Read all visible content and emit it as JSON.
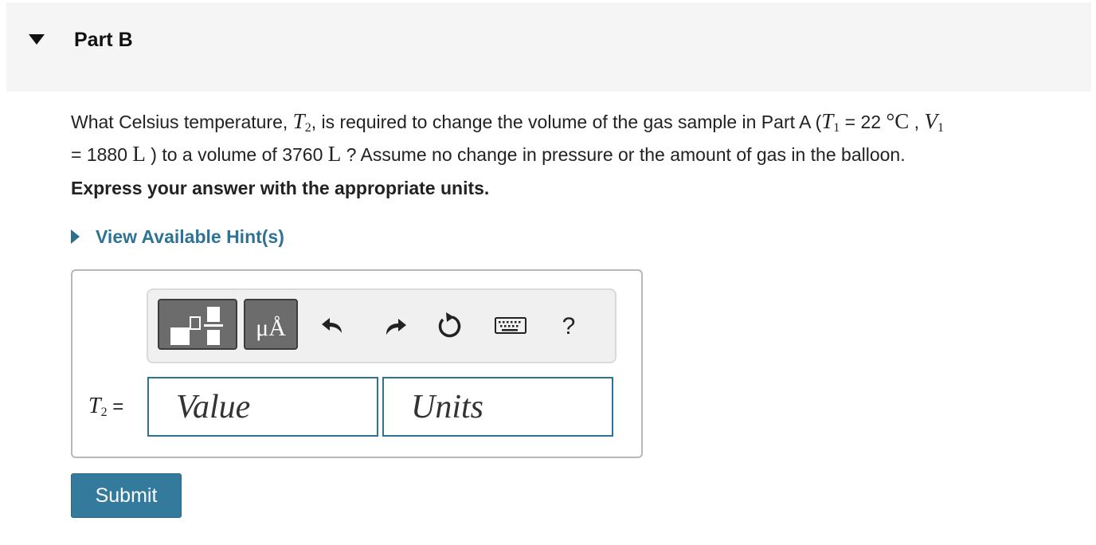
{
  "part": {
    "title": "Part B"
  },
  "question": {
    "text_1": "What Celsius temperature, ",
    "t2_var": "T",
    "t2_sub": "2",
    "text_2": ", is required to change the volume of the gas sample in Part A (",
    "t1_var": "T",
    "t1_sub": "1",
    "t1_eq": " = 22 ",
    "t1_unit": "°C",
    "comma": " , ",
    "v1_var": "V",
    "v1_sub": "1",
    "v1_eq": " = 1880 ",
    "v1_unit": "L",
    "text_3": " ) to a volume of 3760 ",
    "v2_unit": "L",
    "text_4": " ? Assume no change in pressure or the amount of gas in the balloon."
  },
  "instruction": "Express your answer with the appropriate units.",
  "hint": {
    "label": "View Available Hint(s)"
  },
  "toolbar": {
    "units_label": "μÅ",
    "help_label": "?",
    "icons": [
      "templates-icon",
      "units-icon",
      "undo-icon",
      "redo-icon",
      "reset-icon",
      "keyboard-icon",
      "help-icon"
    ]
  },
  "answer": {
    "var": "T",
    "sub": "2",
    "equals": " =",
    "value_placeholder": "Value",
    "units_placeholder": "Units"
  },
  "submit_label": "Submit",
  "colors": {
    "accent": "#2e7396",
    "submit_bg": "#337a9c",
    "header_bg": "#f5f5f5",
    "toolbar_btn": "#6c6c6c"
  }
}
